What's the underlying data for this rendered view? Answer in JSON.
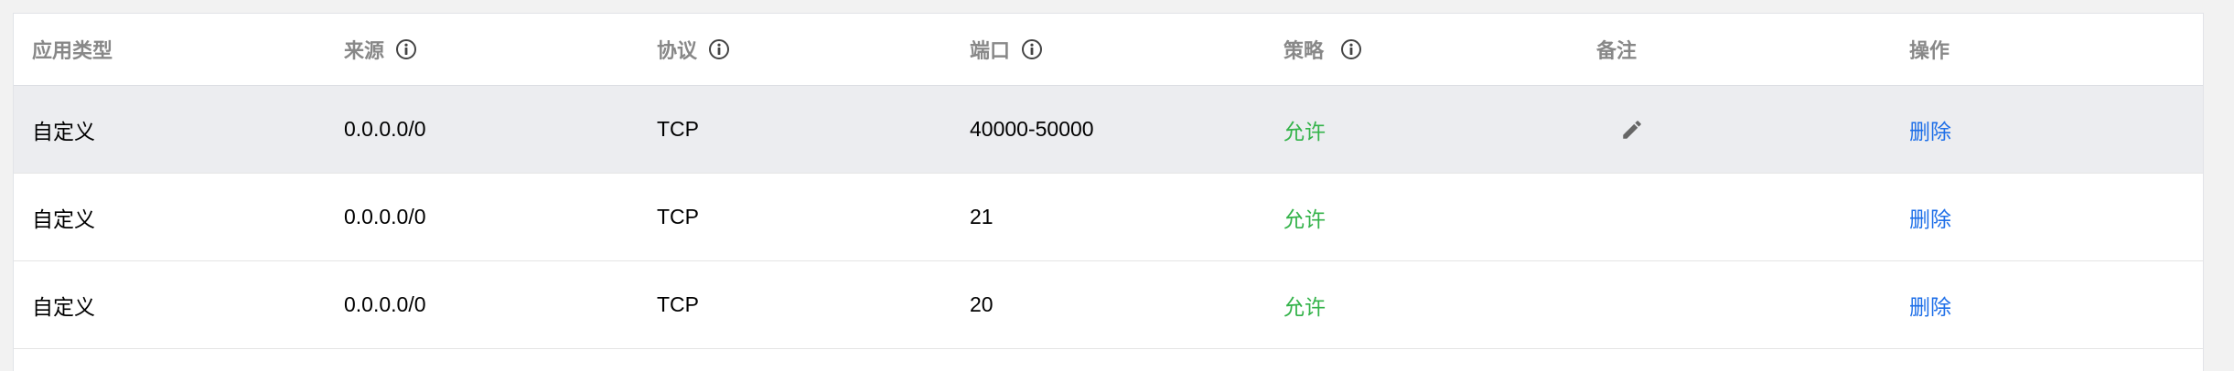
{
  "table": {
    "columns": [
      {
        "label": "应用类型",
        "info": false
      },
      {
        "label": "来源",
        "info": true
      },
      {
        "label": "协议",
        "info": true
      },
      {
        "label": "端口",
        "info": true
      },
      {
        "label": "策略",
        "info": true
      },
      {
        "label": "备注",
        "info": false
      },
      {
        "label": "操作",
        "info": false
      }
    ],
    "rows": [
      {
        "app_type": "自定义",
        "source": "0.0.0.0/0",
        "protocol": "TCP",
        "port": "40000-50000",
        "policy": "允许",
        "note": "",
        "action": "删除"
      },
      {
        "app_type": "自定义",
        "source": "0.0.0.0/0",
        "protocol": "TCP",
        "port": "21",
        "policy": "允许",
        "note": "",
        "action": "删除"
      },
      {
        "app_type": "自定义",
        "source": "0.0.0.0/0",
        "protocol": "TCP",
        "port": "20",
        "policy": "允许",
        "note": "",
        "action": "删除"
      }
    ]
  },
  "icons": {
    "info": "info-circle-icon",
    "edit_note": "pencil-icon"
  },
  "colors": {
    "allow": "#34b34a",
    "link": "#1e6fe8",
    "header_text": "#888888",
    "hover_row": "#ecedf0"
  }
}
